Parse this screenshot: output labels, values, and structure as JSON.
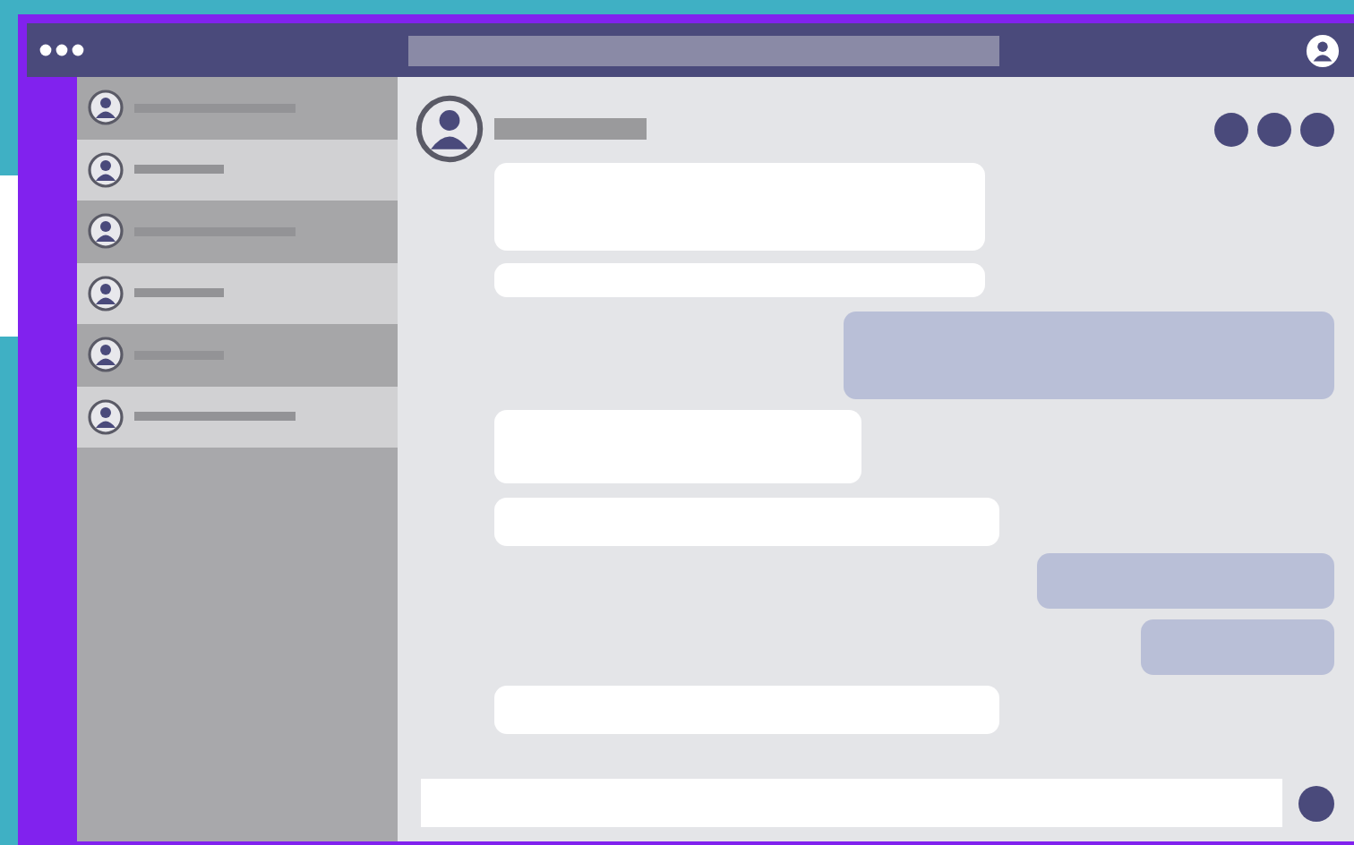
{
  "contacts": [
    {
      "highlighted": false
    },
    {
      "highlighted": true
    },
    {
      "highlighted": false
    },
    {
      "highlighted": true
    },
    {
      "highlighted": false
    },
    {
      "highlighted": true
    }
  ],
  "messages": [
    {
      "kind": "incoming"
    },
    {
      "kind": "incoming"
    },
    {
      "kind": "outgoing"
    },
    {
      "kind": "incoming"
    },
    {
      "kind": "incoming"
    },
    {
      "kind": "outgoing"
    },
    {
      "kind": "outgoing"
    },
    {
      "kind": "incoming"
    }
  ]
}
